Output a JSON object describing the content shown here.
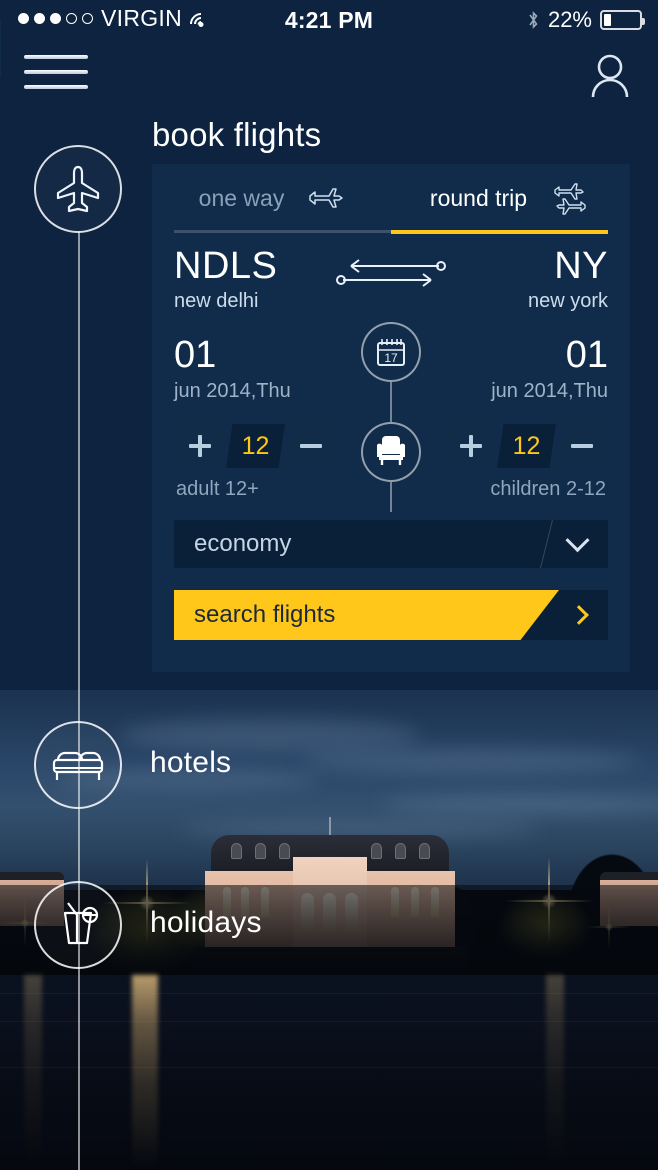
{
  "status_bar": {
    "carrier": "VIRGIN",
    "signal_dots_filled": 3,
    "signal_dots_total": 5,
    "time": "4:21 PM",
    "battery_percent": "22%",
    "battery_level": 22,
    "wifi_icon": "wifi-icon",
    "bluetooth_icon": "bluetooth-icon"
  },
  "nav": {
    "menu_icon": "hamburger-menu-icon",
    "profile_icon": "user-profile-icon"
  },
  "page": {
    "title": "book flights"
  },
  "rail": {
    "items": [
      {
        "label": "",
        "icon": "airplane-icon",
        "active": true
      },
      {
        "label": "hotels",
        "icon": "bed-icon",
        "active": false
      },
      {
        "label": "holidays",
        "icon": "cocktail-icon",
        "active": false
      }
    ],
    "hotels_label": "hotels",
    "holidays_label": "holidays"
  },
  "tabs": {
    "one_way": {
      "label": "one way",
      "icon": "airplane-side-icon",
      "active": false
    },
    "round_trip": {
      "label": "round trip",
      "icon": "two-airplanes-icon",
      "active": true
    }
  },
  "route": {
    "from": {
      "code": "NDLS",
      "city": "new delhi"
    },
    "to": {
      "code": "NY",
      "city": "new york"
    },
    "swap_icon": "swap-arrows-icon"
  },
  "dates": {
    "calendar_icon": "calendar-icon",
    "calendar_day": "17",
    "depart": {
      "day": "01",
      "rest": "jun 2014,Thu"
    },
    "return": {
      "day": "01",
      "rest": "jun 2014,Thu"
    }
  },
  "passengers": {
    "seat_icon": "seat-icon",
    "adults": {
      "value": "12",
      "label": "adult 12+",
      "plus": "+",
      "minus": "-"
    },
    "children": {
      "value": "12",
      "label": "children 2-12",
      "plus": "+",
      "minus": "-"
    }
  },
  "cabin_class": {
    "value": "economy",
    "chevron_icon": "chevron-down-icon"
  },
  "search": {
    "label": "search flights",
    "chevron_icon": "chevron-right-icon"
  },
  "colors": {
    "accent_yellow": "#ffc719",
    "card_navy": "#112c4a",
    "field_dark": "#0a2038",
    "text_muted": "#8fa6bd"
  }
}
